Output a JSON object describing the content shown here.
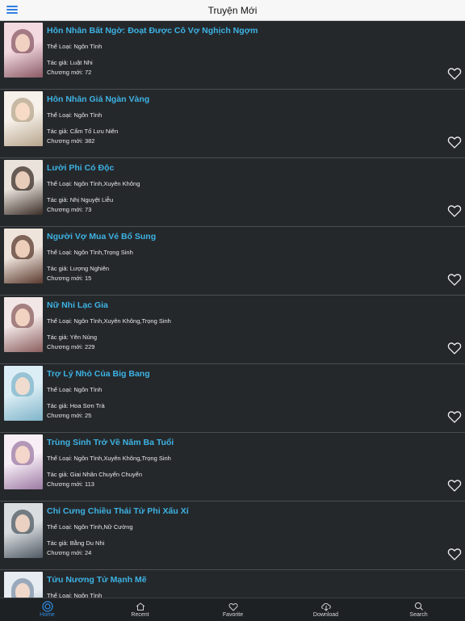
{
  "header": {
    "title": "Truyện Mới"
  },
  "labels": {
    "genre": "Thể Loại: ",
    "author": "Tác giả: ",
    "chapter": "Chương mới: "
  },
  "colors": {
    "accent": "#3db3e4",
    "tab_active": "#2f8fe0",
    "background": "#25282b"
  },
  "stories": [
    {
      "title": "Hôn Nhân Bất Ngờ: Đoạt Được Cô Vợ Nghịch Ngợm",
      "genre": "Ngôn Tình",
      "author": "Luật Nhi",
      "chapter": "72",
      "favorite": false,
      "cover_colors": [
        "#f3d9e0",
        "#8a5a66"
      ]
    },
    {
      "title": "Hôn Nhân Giá Ngàn Vàng",
      "genre": "Ngôn Tình",
      "author": "Cẩm Tố Lưu Niên",
      "chapter": "382",
      "favorite": false,
      "cover_colors": [
        "#f6f1ea",
        "#b7a58c"
      ]
    },
    {
      "title": "Lười Phi Có Độc",
      "genre": "Ngôn Tình,Xuyên Không",
      "author": "Nhị Nguyệt Liễu",
      "chapter": "73",
      "favorite": false,
      "cover_colors": [
        "#e9e3dc",
        "#3b2d27"
      ]
    },
    {
      "title": "Người Vợ Mua Vé Bổ Sung",
      "genre": "Ngôn Tình,Trọng Sinh",
      "author": "Lượng Nghiên",
      "chapter": "15",
      "favorite": false,
      "cover_colors": [
        "#efe4dc",
        "#5a3a2e"
      ]
    },
    {
      "title": "Nữ Nhi Lạc Gia",
      "genre": "Ngôn Tình,Xuyên Không,Trọng Sinh",
      "author": "Yên Nùng",
      "chapter": "229",
      "favorite": false,
      "cover_colors": [
        "#f2e6e6",
        "#8b5e5e"
      ]
    },
    {
      "title": "Trợ Lý Nhỏ Của Big Bang",
      "genre": "Ngôn Tình",
      "author": "Hoa Sơn Trà",
      "chapter": "25",
      "favorite": false,
      "cover_colors": [
        "#dceef5",
        "#7fb4c9"
      ]
    },
    {
      "title": "Trùng Sinh Trở Về Năm Ba Tuổi",
      "genre": "Ngôn Tình,Xuyên Không,Trọng Sinh",
      "author": "Giai Nhân Chuyển Chuyển",
      "chapter": "113",
      "favorite": false,
      "cover_colors": [
        "#f7eef6",
        "#9c7aa3"
      ]
    },
    {
      "title": "Chỉ Cưng Chiều Thái Tử Phi Xấu Xí",
      "genre": "Ngôn Tình,Nữ Cường",
      "author": "Bằng Du Nhi",
      "chapter": "24",
      "favorite": false,
      "cover_colors": [
        "#d9dde0",
        "#4f5963"
      ]
    },
    {
      "title": "Tửu Nương Tử Mạnh Mẽ",
      "genre": "Ngôn Tình",
      "author": "",
      "chapter": "",
      "favorite": false,
      "cover_colors": [
        "#e6ecf2",
        "#7f93a8"
      ]
    }
  ],
  "tabs": [
    {
      "label": "Home",
      "icon": "home-icon",
      "active": true
    },
    {
      "label": "Recent",
      "icon": "recent-icon",
      "active": false
    },
    {
      "label": "Favorite",
      "icon": "heart-icon",
      "active": false
    },
    {
      "label": "Download",
      "icon": "download-icon",
      "active": false
    },
    {
      "label": "Search",
      "icon": "search-icon",
      "active": false
    }
  ]
}
